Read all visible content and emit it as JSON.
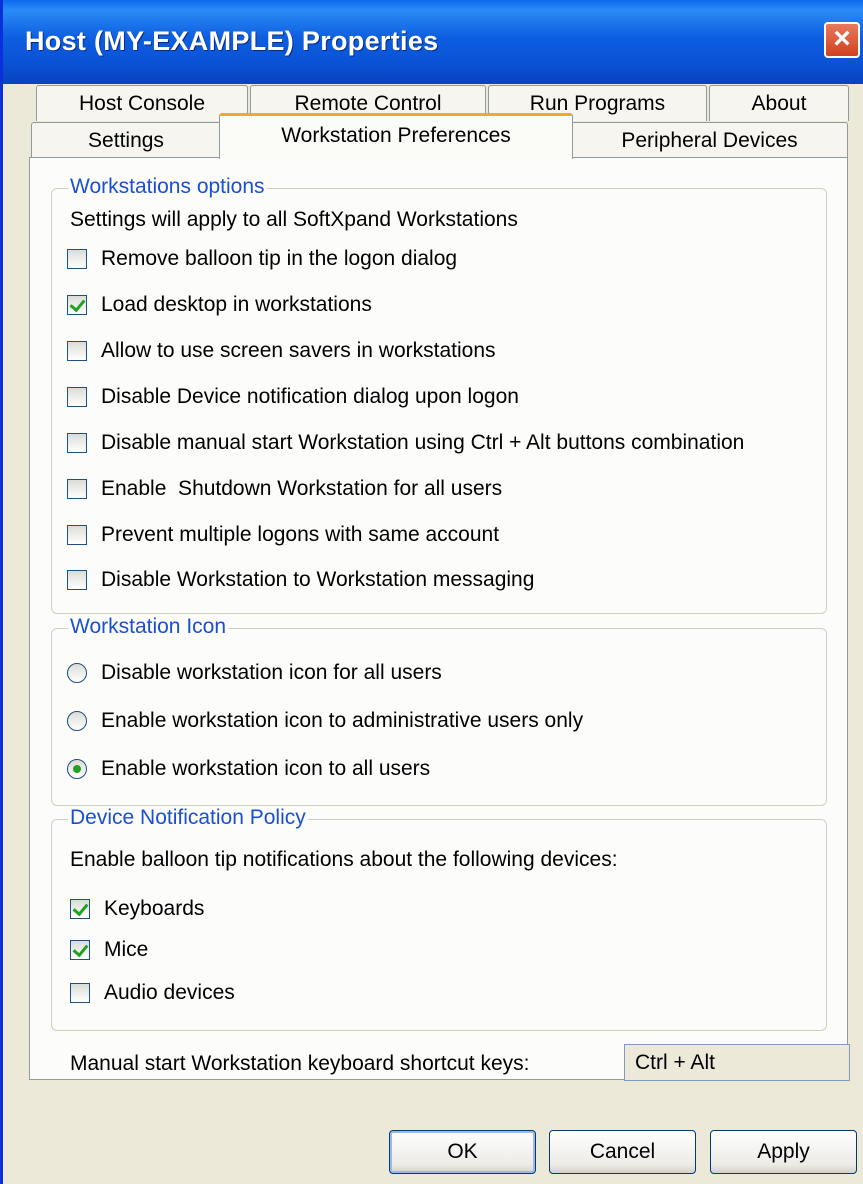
{
  "window": {
    "title": "Host (MY-EXAMPLE) Properties",
    "close_icon": "close-icon"
  },
  "tabs": {
    "row1": [
      "Host Console",
      "Remote Control",
      "Run Programs",
      "About"
    ],
    "row2": [
      "Settings",
      "Workstation Preferences",
      "Peripheral Devices"
    ],
    "active": "Workstation Preferences",
    "active_accent": "#f0a830"
  },
  "workstation_options": {
    "legend": "Workstations options",
    "description": "Settings will apply to all SoftXpand Workstations",
    "items": [
      {
        "label": "Remove balloon tip in the logon dialog",
        "checked": false
      },
      {
        "label": "Load desktop in workstations",
        "checked": true
      },
      {
        "label": "Allow to use screen savers in workstations",
        "checked": false
      },
      {
        "label": "Disable Device notification dialog upon logon",
        "checked": false
      },
      {
        "label": "Disable manual start Workstation using Ctrl + Alt buttons combination",
        "checked": false
      },
      {
        "label": "Enable  Shutdown Workstation for all users",
        "checked": false
      },
      {
        "label": "Prevent multiple logons with same account",
        "checked": false
      },
      {
        "label": "Disable Workstation to Workstation messaging",
        "checked": false
      }
    ]
  },
  "workstation_icon": {
    "legend": "Workstation Icon",
    "options": [
      {
        "label": "Disable workstation icon for all users",
        "selected": false
      },
      {
        "label": "Enable workstation icon to administrative users only",
        "selected": false
      },
      {
        "label": "Enable workstation icon to all users",
        "selected": true
      }
    ]
  },
  "device_notification": {
    "legend": "Device Notification Policy",
    "description": "Enable balloon tip notifications about the following devices:",
    "items": [
      {
        "label": "Keyboards",
        "checked": true
      },
      {
        "label": "Mice",
        "checked": true
      },
      {
        "label": "Audio devices",
        "checked": false
      }
    ]
  },
  "shortcut": {
    "label": "Manual start Workstation keyboard shortcut keys:",
    "value": "Ctrl + Alt"
  },
  "buttons": {
    "ok": "OK",
    "cancel": "Cancel",
    "apply": "Apply"
  },
  "colors": {
    "titlebar": "#0a52d6",
    "legend_text": "#1c4fd0",
    "check_mark": "#21a121",
    "dialog_bg": "#ece9d8"
  }
}
